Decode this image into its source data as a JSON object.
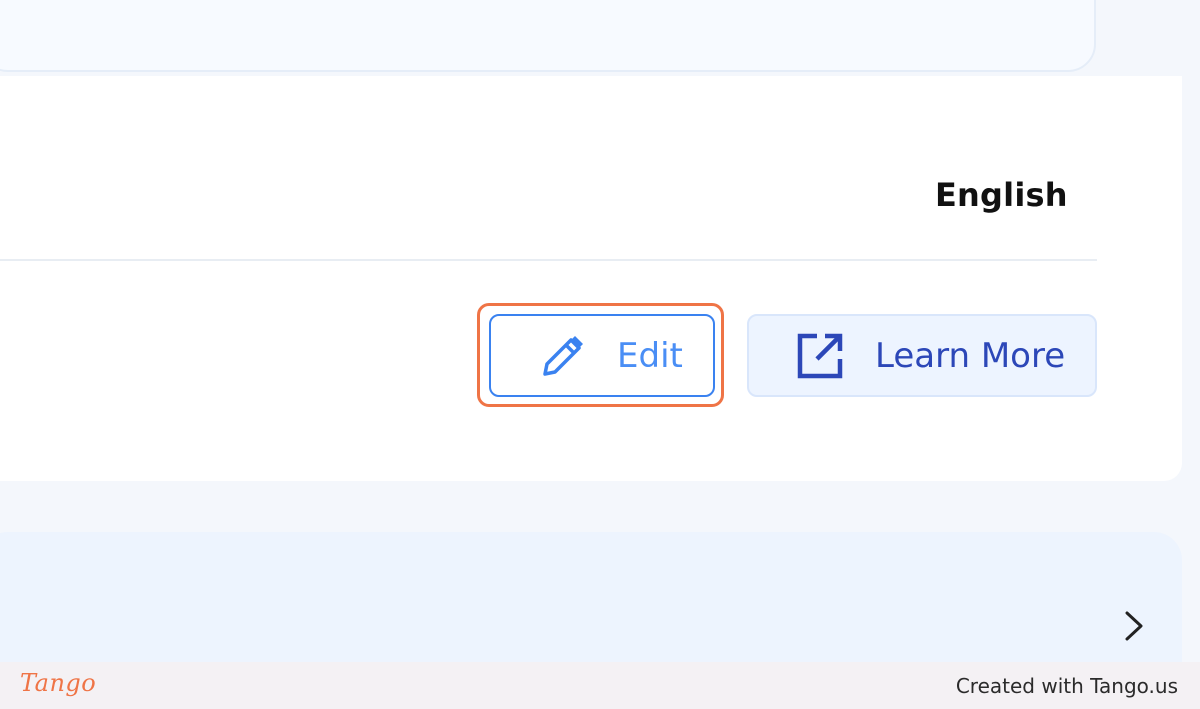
{
  "settings": {
    "language_value": "English"
  },
  "actions": {
    "edit_label": "Edit",
    "learn_more_label": "Learn More"
  },
  "icons": {
    "edit": "pencil-icon",
    "learn_more": "external-link-icon",
    "expand": "chevron-right-icon"
  },
  "footer": {
    "logo": "Tango",
    "credit": "Created with Tango.us"
  },
  "colors": {
    "highlight": "#ef7446",
    "edit_accent": "#3a82f0",
    "learn_more_text": "#2c47b8"
  }
}
